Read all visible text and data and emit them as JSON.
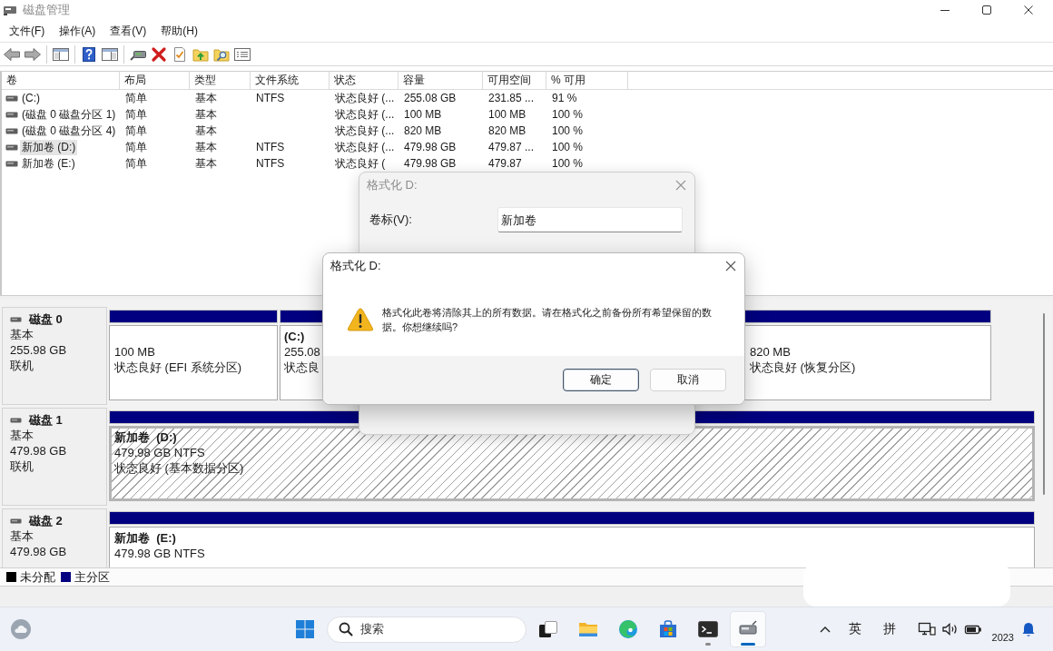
{
  "window": {
    "title": "磁盘管理",
    "active": false
  },
  "menu": [
    {
      "label": "文件(F)"
    },
    {
      "label": "操作(A)"
    },
    {
      "label": "查看(V)"
    },
    {
      "label": "帮助(H)"
    }
  ],
  "volume_table": {
    "columns": [
      "卷",
      "布局",
      "类型",
      "文件系统",
      "状态",
      "容量",
      "可用空间",
      "% 可用"
    ],
    "rows": [
      {
        "volume": "(C:)",
        "layout": "简单",
        "type": "基本",
        "file_system": "NTFS",
        "status": "状态良好 (...",
        "capacity": "255.08 GB",
        "free_space": "231.85 ...",
        "percent_free": "91 %",
        "selected": false
      },
      {
        "volume": "(磁盘 0 磁盘分区 1)",
        "layout": "简单",
        "type": "基本",
        "status": "状态良好 (...",
        "capacity": "100 MB",
        "free_space": "100 MB",
        "percent_free": "100 %",
        "selected": false
      },
      {
        "volume": "(磁盘 0 磁盘分区 4)",
        "layout": "简单",
        "type": "基本",
        "status": "状态良好 (...",
        "capacity": "820 MB",
        "free_space": "820 MB",
        "percent_free": "100 %",
        "selected": false
      },
      {
        "volume": "新加卷 (D:)",
        "layout": "简单",
        "type": "基本",
        "file_system": "NTFS",
        "status": "状态良好 (...",
        "capacity": "479.98 GB",
        "free_space": "479.87 ...",
        "percent_free": "100 %",
        "selected": true
      },
      {
        "volume": "新加卷 (E:)",
        "layout": "简单",
        "type": "基本",
        "file_system": "NTFS",
        "status": "状态良好 (",
        "capacity": "479.98 GB",
        "free_space": "479.87",
        "percent_free": "100 %",
        "selected": false
      }
    ]
  },
  "disks": [
    {
      "name": "磁盘 0",
      "type": "基本",
      "size": "255.98 GB",
      "status": "联机",
      "partitions": [
        {
          "size": "100 MB",
          "status": "状态良好 (EFI 系统分区)",
          "selected": false
        },
        {
          "name": "(C:)",
          "size": "255.08",
          "status": "状态良",
          "selected": false
        },
        {
          "size": "820 MB",
          "status": "状态良好 (恢复分区)",
          "selected": false
        }
      ]
    },
    {
      "name": "磁盘 1",
      "type": "基本",
      "size": "479.98 GB",
      "status": "联机",
      "partitions": [
        {
          "name": "新加卷  (D:)",
          "size": "479.98 GB NTFS",
          "status": "状态良好 (基本数据分区)",
          "selected": true
        }
      ]
    },
    {
      "name": "磁盘 2",
      "type": "基本",
      "size": "479.98 GB",
      "partitions": [
        {
          "name": "新加卷  (E:)",
          "size": "479.98 GB NTFS",
          "selected": false
        }
      ]
    }
  ],
  "legend": [
    {
      "label": "未分配",
      "color": "#000000"
    },
    {
      "label": "主分区",
      "color": "#000080"
    }
  ],
  "format_dialog": {
    "title": "格式化 D:",
    "active": false,
    "fields": [
      {
        "label": "卷标(V):",
        "value": "新加卷"
      }
    ]
  },
  "confirm_dialog": {
    "title": "格式化 D:",
    "active": true,
    "message": "格式化此卷将清除其上的所有数据。请在格式化之前备份所有希望保留的数据。你想继续吗?",
    "buttons": [
      {
        "label": "确定",
        "default": true
      },
      {
        "label": "取消",
        "default": false
      }
    ]
  },
  "taskbar": {
    "search": {
      "placeholder": "搜索"
    },
    "apps": [
      {
        "kind": "taskview",
        "running": false,
        "selected": false
      },
      {
        "kind": "explorer",
        "running": false,
        "selected": false
      },
      {
        "kind": "browser",
        "running": false,
        "selected": false
      },
      {
        "kind": "store",
        "running": false,
        "selected": false
      },
      {
        "kind": "terminal",
        "running": true,
        "selected": false
      },
      {
        "kind": "diskmgmt",
        "running": true,
        "selected": true
      }
    ],
    "input_methods": [
      {
        "label": "英"
      },
      {
        "label": "拼"
      }
    ],
    "date": "2023"
  }
}
